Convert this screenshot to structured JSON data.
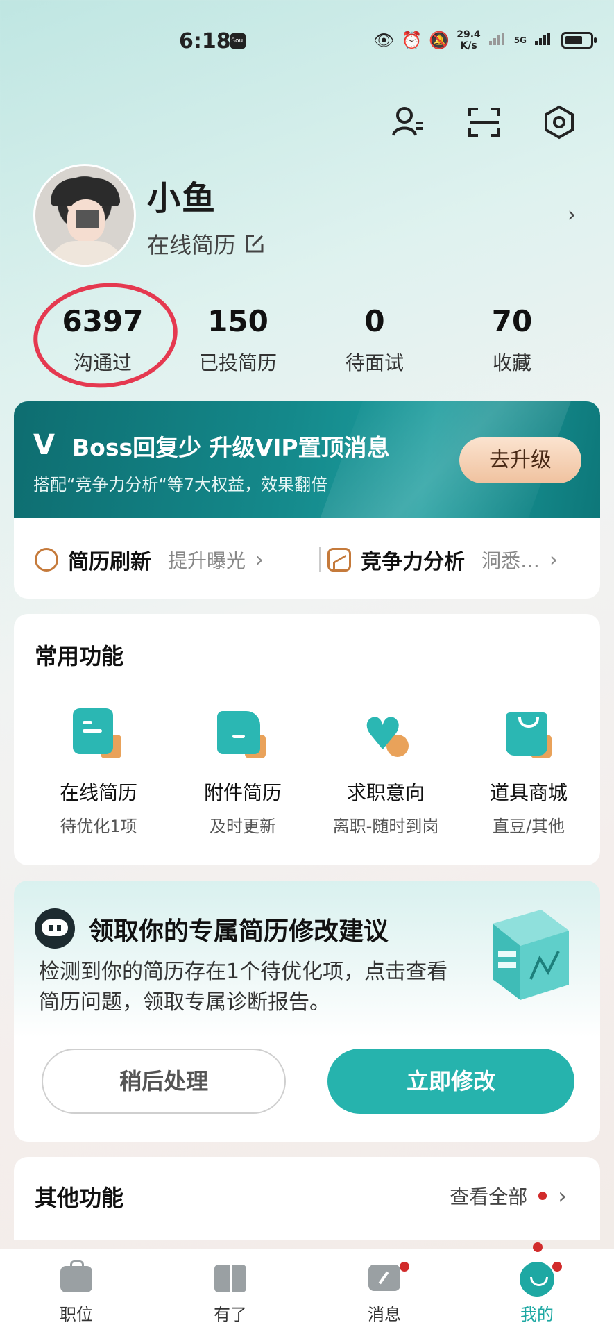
{
  "status_bar": {
    "time": "6:18",
    "sim_label": "Soul",
    "net_speed_top": "29.4",
    "net_speed_bottom": "K/s",
    "signal_label": "5G"
  },
  "profile": {
    "name": "小鱼",
    "resume_link": "在线简历"
  },
  "stats": [
    {
      "value": "6397",
      "label": "沟通过"
    },
    {
      "value": "150",
      "label": "已投简历"
    },
    {
      "value": "0",
      "label": "待面试"
    },
    {
      "value": "70",
      "label": "收藏"
    }
  ],
  "vip_banner": {
    "logo": "V",
    "title": "Boss回复少 升级VIP置顶消息",
    "subtitle": "搭配“竞争力分析“等7大权益，效果翻倍",
    "button": "去升级"
  },
  "quick_links": [
    {
      "title": "简历刷新",
      "desc": "提升曝光"
    },
    {
      "title": "竞争力分析",
      "desc": "洞悉…"
    }
  ],
  "common_functions": {
    "title": "常用功能",
    "items": [
      {
        "name": "在线简历",
        "sub": "待优化1项"
      },
      {
        "name": "附件简历",
        "sub": "及时更新"
      },
      {
        "name": "求职意向",
        "sub": "离职-随时到岗"
      },
      {
        "name": "道具商城",
        "sub": "直豆/其他"
      }
    ]
  },
  "resume_advice": {
    "title": "领取你的专属简历修改建议",
    "body": "检测到你的简历存在1个待优化项，点击查看简历问题，领取专属诊断报告。",
    "later_button": "稍后处理",
    "now_button": "立即修改"
  },
  "other_functions": {
    "title": "其他功能",
    "view_all": "查看全部"
  },
  "tabbar": [
    {
      "label": "职位"
    },
    {
      "label": "有了"
    },
    {
      "label": "消息"
    },
    {
      "label": "我的"
    }
  ],
  "colors": {
    "accent": "#26b3ad",
    "vip_bg": "#14888a",
    "annotation_circle": "#e53950",
    "badge_red": "#d12b2b"
  }
}
